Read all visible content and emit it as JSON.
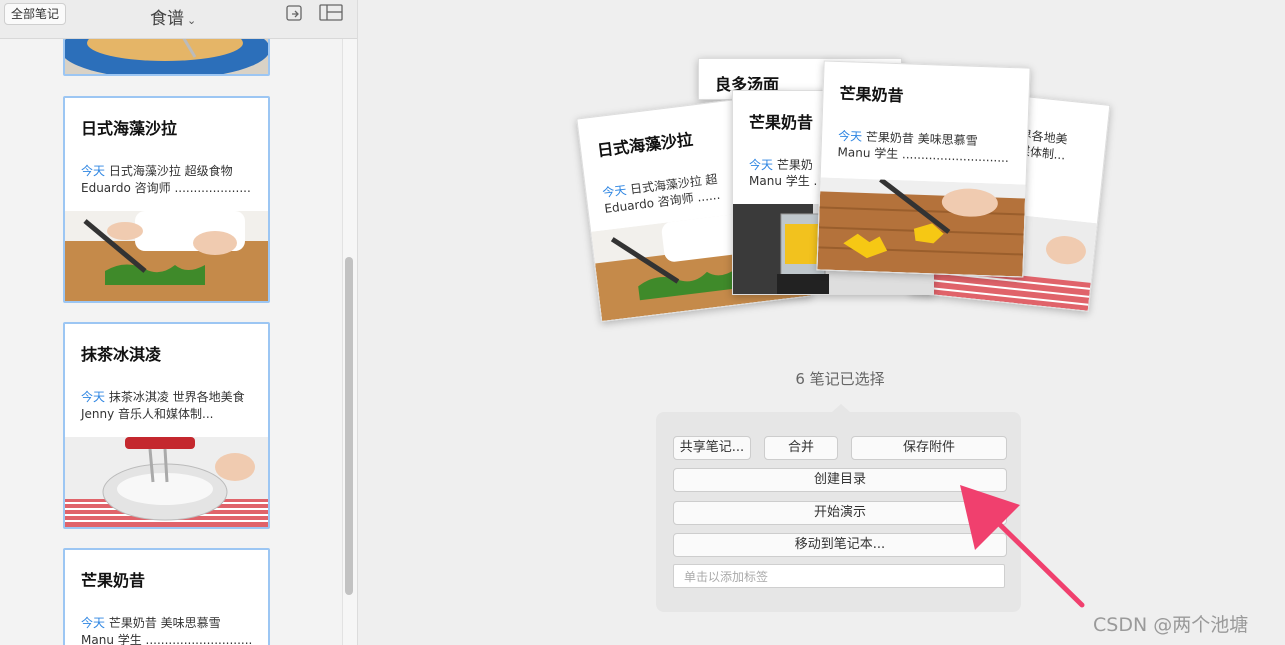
{
  "toolbar": {
    "all_notes_label": "全部笔记",
    "notebook_title": "食谱",
    "icons": [
      "share-arrow-icon",
      "layout-grid-icon"
    ]
  },
  "note_list": [
    {
      "title": "日式海藻沙拉",
      "today_label": "今天",
      "snippet": "日式海藻沙拉 超级食物 Eduardo 咨询师 ....................",
      "image": "chopping-greens-photo"
    },
    {
      "title": "抹茶冰淇凌",
      "today_label": "今天",
      "snippet": "抹茶冰淇凌 世界各地美食 Jenny 音乐人和媒体制...",
      "image": "mixer-bowl-photo"
    },
    {
      "title": "芒果奶昔",
      "today_label": "今天",
      "snippet": "芒果奶昔 美味思慕雪 Manu 学生 ............................",
      "image": ""
    }
  ],
  "stack": {
    "back_title": "良多汤面",
    "left_title": "日式海藻沙拉",
    "left_snippet_line1": "日式海藻沙拉 超",
    "left_snippet_line2": "Eduardo 咨询师 ......",
    "mid_title": "芒果奶昔",
    "mid_snippet_line1": "芒果奶",
    "mid_snippet_line2": "Manu 学生 .",
    "front_title": "芒果奶昔",
    "front_snippet_line1": "芒果奶昔 美味思慕雪",
    "front_snippet_line2": "Manu 学生 ............................",
    "right_snippet_line1": "界各地美",
    "right_snippet_line2": "媒体制...",
    "today_label": "今天"
  },
  "selection": {
    "count_text": "6 笔记已选择"
  },
  "actions": {
    "share": "共享笔记...",
    "merge": "合并",
    "save_attachments": "保存附件",
    "create_toc": "创建目录",
    "present": "开始演示",
    "move": "移动到笔记本...",
    "tag_placeholder": "单击以添加标签"
  },
  "watermark": "CSDN @两个池塘",
  "colors": {
    "accent_blue": "#2f86e2",
    "card_border": "#9cc6f3",
    "arrow_pink": "#f0406e"
  }
}
